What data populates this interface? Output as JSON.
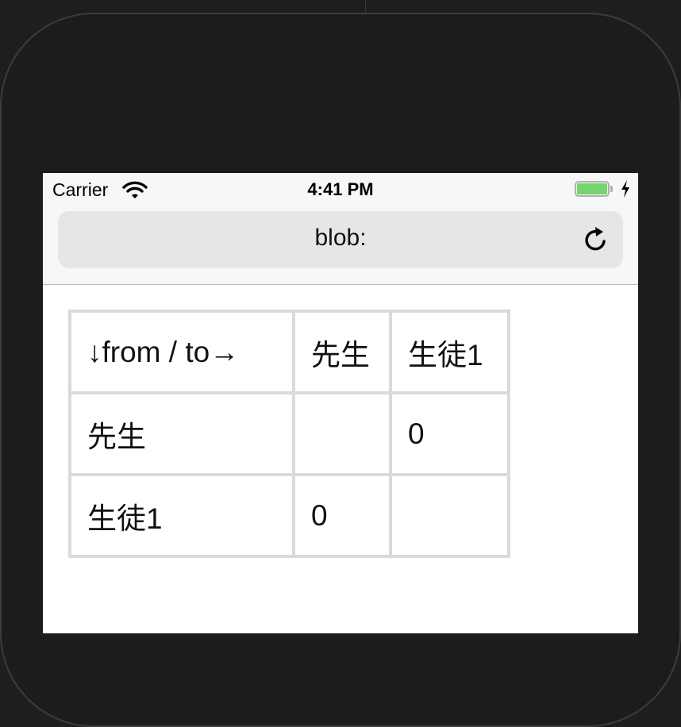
{
  "status_bar": {
    "carrier": "Carrier",
    "time": "4:41 PM",
    "battery_level": 1.0,
    "icons": [
      "wifi-icon",
      "battery-icon",
      "charging-bolt-icon"
    ]
  },
  "url_bar": {
    "text": "blob:",
    "reload_icon": "reload-icon"
  },
  "table": {
    "header": [
      "↓from / to→",
      "先生",
      "生徒1"
    ],
    "rows": [
      [
        "先生",
        "",
        "0"
      ],
      [
        "生徒1",
        "0",
        ""
      ]
    ]
  },
  "colors": {
    "battery": "#72d66c",
    "url_bar_bg": "#e5e6e8",
    "table_border": "#dadada"
  }
}
